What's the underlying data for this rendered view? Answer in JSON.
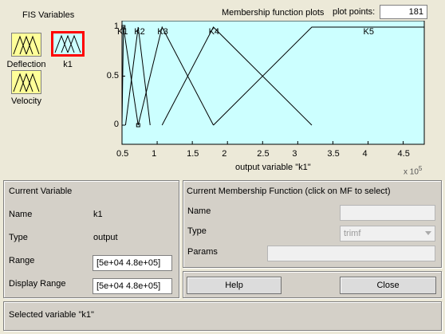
{
  "fis_variables": {
    "title": "FIS Variables",
    "inputs": [
      {
        "label": "Deflection"
      },
      {
        "label": "Velocity"
      }
    ],
    "outputs": [
      {
        "label": "k1"
      }
    ]
  },
  "plot": {
    "title": "Membership function plots",
    "plot_points_label": "plot points:",
    "plot_points_value": "181",
    "xlabel": "output variable \"k1\"",
    "x_exponent": "x 10",
    "x_exponent_power": "5",
    "x_ticks": [
      "0.5",
      "1",
      "1.5",
      "2",
      "2.5",
      "3",
      "3.5",
      "4",
      "4.5"
    ],
    "y_ticks": [
      "1",
      "0.5",
      "0"
    ],
    "mf_labels": [
      "K1",
      "K2",
      "K3",
      "K4",
      "K5"
    ],
    "background": "#ccffff"
  },
  "chart_data": {
    "type": "line",
    "xlabel": "output variable \"k1\"",
    "xlim": [
      50000,
      480000
    ],
    "ylim": [
      0,
      1
    ],
    "series": [
      {
        "name": "K1",
        "x": [
          50000,
          52000,
          73000
        ],
        "y": [
          0,
          1,
          0
        ]
      },
      {
        "name": "K2",
        "x": [
          55000,
          73000,
          90000
        ],
        "y": [
          0,
          1,
          0
        ]
      },
      {
        "name": "K3",
        "x": [
          73000,
          107000,
          180000
        ],
        "y": [
          0,
          1,
          0
        ]
      },
      {
        "name": "K4",
        "x": [
          107000,
          180000,
          320000
        ],
        "y": [
          0,
          1,
          0
        ]
      },
      {
        "name": "K5",
        "x": [
          180000,
          320000,
          480000
        ],
        "y": [
          0,
          1,
          1
        ]
      }
    ]
  },
  "current_variable": {
    "title": "Current Variable",
    "name_label": "Name",
    "name_value": "k1",
    "type_label": "Type",
    "type_value": "output",
    "range_label": "Range",
    "range_value": "[5e+04 4.8e+05]",
    "display_range_label": "Display Range",
    "display_range_value": "[5e+04 4.8e+05]"
  },
  "current_mf": {
    "title": "Current Membership Function (click on MF to select)",
    "name_label": "Name",
    "name_value": "",
    "type_label": "Type",
    "type_value": "trimf",
    "params_label": "Params",
    "params_value": ""
  },
  "buttons": {
    "help": "Help",
    "close": "Close"
  },
  "status": {
    "text": "Selected variable \"k1\""
  },
  "colors": {
    "input_icon": "#ffff99",
    "output_icon": "#ccffff",
    "selected_border": "#ff0000"
  }
}
